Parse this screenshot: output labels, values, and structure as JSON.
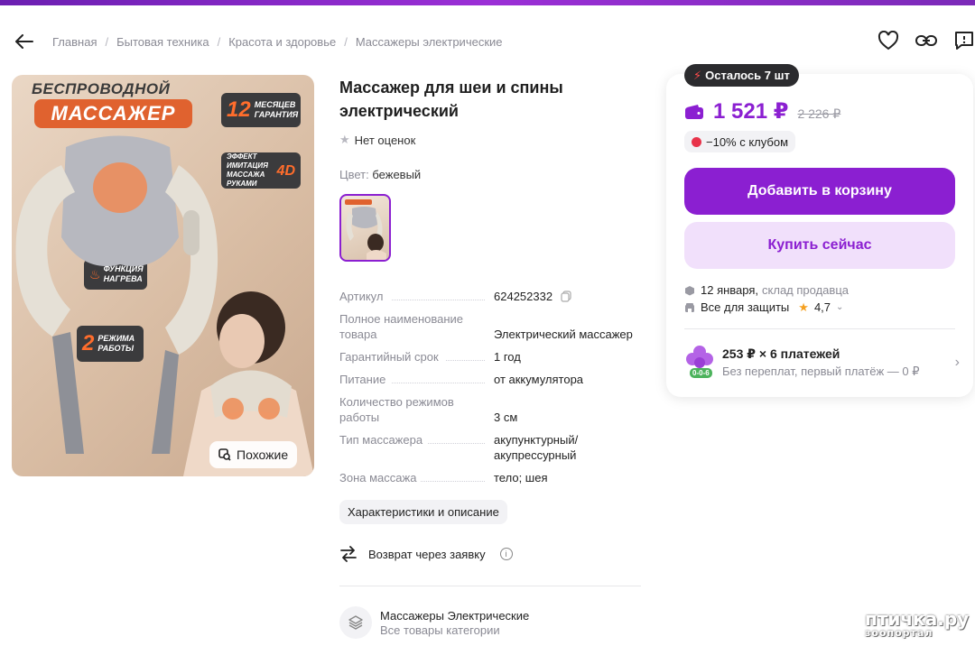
{
  "breadcrumbs": [
    "Главная",
    "Бытовая техника",
    "Красота и здоровье",
    "Массажеры электрические"
  ],
  "photo": {
    "line1": "БЕСПРОВОДНОЙ",
    "line2": "МАССАЖЕР",
    "warranty_num": "12",
    "warranty_text": "МЕСЯЦЕВ ГАРАНТИЯ",
    "effect_text": "ЭФФЕКТ ИМИТАЦИЯ МАССАЖА РУКАМИ",
    "effect_badge": "4D",
    "heat_text": "ФУНКЦИЯ НАГРЕВА",
    "modes_num": "2",
    "modes_text": "РЕЖИМА РАБОТЫ",
    "similar_label": "Похожие"
  },
  "product": {
    "title": "Массажер для шеи и спины электрический",
    "rating_text": "Нет оценок",
    "color_label": "Цвет:",
    "color_value": "бежевый",
    "specs": [
      {
        "k": "Артикул",
        "v": "624252332"
      },
      {
        "k": "Полное наименование товара",
        "v": "Электрический массажер"
      },
      {
        "k": "Гарантийный срок",
        "v": "1 год"
      },
      {
        "k": "Питание",
        "v": "от аккумулятора"
      },
      {
        "k": "Количество режимов работы",
        "v": "3 см"
      },
      {
        "k": "Тип массажера",
        "v": "акупунктурный/ акупрессурный"
      },
      {
        "k": "Зона массажа",
        "v": "тело; шея"
      }
    ],
    "desc_button": "Характеристики и описание",
    "return_text": "Возврат через заявку",
    "category_title": "Массажеры Электрические",
    "category_sub": "Все товары категории"
  },
  "buybox": {
    "stock": "Осталось 7 шт",
    "price": "1 521 ₽",
    "old_price": "2 226 ₽",
    "club": "−10% с клубом",
    "add_to_cart": "Добавить в корзину",
    "buy_now": "Купить сейчас",
    "delivery_date": "12 января,",
    "delivery_source": "склад продавца",
    "protection": "Все для защиты",
    "seller_rating": "4,7",
    "installment_title": "253 ₽ × 6 платежей",
    "installment_sub": "Без переплат, первый платёж — 0 ₽",
    "installment_tag": "0-0-6"
  },
  "watermark": {
    "line1": "птичка.ру",
    "line2": "зоопортал"
  },
  "colors": {
    "accent": "#8b1fd1",
    "accent_light": "#f1e0fb",
    "orange": "#e0622f"
  }
}
